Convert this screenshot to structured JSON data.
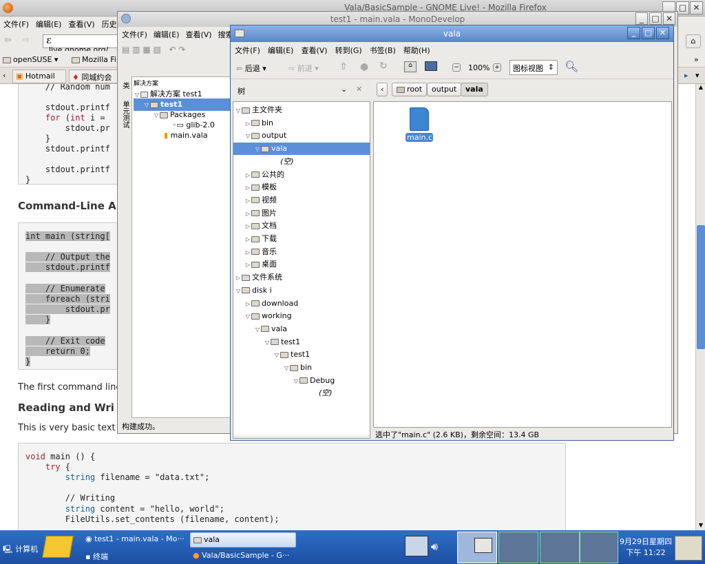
{
  "firefox": {
    "title": "Vala/BasicSample - GNOME Live! - Mozilla Firefox",
    "menu": [
      "文件(F)",
      "编辑(E)",
      "查看(V)",
      "历史(S)"
    ],
    "url": "live.gnome.org/",
    "bookmarks": [
      "openSUSE",
      "Mozilla Fir"
    ],
    "tabs": [
      "Hotmail ···",
      "同城约会 ·"
    ],
    "code1": [
      "    // Random num",
      "    stdout.printf",
      "    for (int i =",
      "        stdout.pr",
      "    }",
      "    stdout.printf",
      "    stdout.printf",
      "}"
    ],
    "heading1": "Command-Line A",
    "code2": [
      "int main (string[",
      "    // Output the",
      "    stdout.printf",
      "    // Enumerate",
      "    foreach (stri",
      "        stdout.pr",
      "    }",
      "    // Exit code",
      "    return 0;",
      "}"
    ],
    "para1": "The first command line",
    "heading2": "Reading and Wri",
    "para2": "This is very basic text f",
    "code3": [
      "void main () {",
      "    try {",
      "        string filename = \"data.txt\";",
      "",
      "        // Writing",
      "        string content = \"hello, world\";",
      "        FileUtils.set_contents (filename, content);"
    ]
  },
  "monodevelop": {
    "title": "test1 - main.vala - MonoDevelop",
    "menu": [
      "文件(F)",
      "编辑(E)",
      "查看(V)",
      "搜索"
    ],
    "pad_title": "解决方案",
    "side_tabs": [
      "类",
      "单元测试"
    ],
    "tree": [
      "解决方案 test1",
      "test1",
      "Packages",
      "glib-2.0",
      "main.vala"
    ],
    "status": "构建成功。"
  },
  "nautilus": {
    "title": "vala",
    "menu": [
      "文件(F)",
      "编辑(E)",
      "查看(V)",
      "转到(G)",
      "书签(B)",
      "帮助(H)"
    ],
    "back": "后退",
    "forward": "前进",
    "zoom": "100%",
    "view_mode": "图标视图",
    "crumbs": [
      "root",
      "output",
      "vala"
    ],
    "sidebar_label": "树",
    "tree": [
      {
        "label": "主文件夹",
        "expander": "▽",
        "level": 0
      },
      {
        "label": "bin",
        "expander": "▷",
        "level": 1
      },
      {
        "label": "output",
        "expander": "▽",
        "level": 1
      },
      {
        "label": "vala",
        "expander": "▽",
        "level": 2,
        "selected": true
      },
      {
        "label": "(空)",
        "expander": "",
        "level": 4
      },
      {
        "label": "公共的",
        "expander": "▷",
        "level": 1
      },
      {
        "label": "模板",
        "expander": "▷",
        "level": 1
      },
      {
        "label": "视频",
        "expander": "▷",
        "level": 1
      },
      {
        "label": "图片",
        "expander": "▷",
        "level": 1
      },
      {
        "label": "文档",
        "expander": "▷",
        "level": 1
      },
      {
        "label": "下载",
        "expander": "▷",
        "level": 1
      },
      {
        "label": "音乐",
        "expander": "▷",
        "level": 1
      },
      {
        "label": "桌面",
        "expander": "▷",
        "level": 1
      },
      {
        "label": "文件系统",
        "expander": "▷",
        "level": 0
      },
      {
        "label": "disk i",
        "expander": "▽",
        "level": 0
      },
      {
        "label": "download",
        "expander": "▷",
        "level": 1
      },
      {
        "label": "working",
        "expander": "▽",
        "level": 1
      },
      {
        "label": "vala",
        "expander": "▽",
        "level": 2
      },
      {
        "label": "test1",
        "expander": "▽",
        "level": 3
      },
      {
        "label": "test1",
        "expander": "▽",
        "level": 4
      },
      {
        "label": "bin",
        "expander": "▽",
        "level": 5
      },
      {
        "label": "Debug",
        "expander": "▽",
        "level": 6
      },
      {
        "label": "(空)",
        "expander": "",
        "level": 8
      }
    ],
    "file": "main.c",
    "status": "选中了\"main.c\" (2.6 KB)，剩余空间：13.4 GB"
  },
  "taskbar": {
    "computer": "计算机",
    "tasks": [
      "test1 - main.vala - Mo···",
      "vala",
      "终端",
      "Vala/BasicSample - G···"
    ],
    "date": "9月29日星期四",
    "time": "下午 11:22"
  }
}
